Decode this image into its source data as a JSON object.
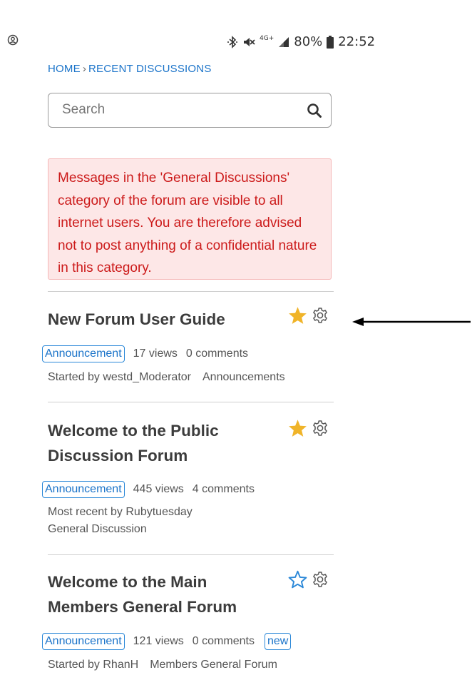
{
  "status_bar": {
    "signal_label": "4G+",
    "battery_percent": "80%",
    "time": "22:52",
    "icons": [
      "account-icon",
      "bluetooth-icon",
      "mute-icon",
      "signal-icon",
      "battery-icon"
    ]
  },
  "breadcrumb": {
    "home": "HOME",
    "separator": "›",
    "current": "RECENT DISCUSSIONS"
  },
  "search": {
    "placeholder": "Search"
  },
  "alert": {
    "message": "Messages in the 'General Discussions' category of the forum are visible to all internet users. You are therefore advised not to post anything of a confidential nature in this category."
  },
  "discussions": [
    {
      "title": "New Forum User Guide",
      "starred": true,
      "badge": "Announcement",
      "views": "17 views",
      "comments": "0 comments",
      "line1": "Started by westd_Moderator",
      "category": "Announcements"
    },
    {
      "title": "Welcome to the Public Discussion Forum",
      "starred": true,
      "badge": "Announcement",
      "views": "445 views",
      "comments": "4 comments",
      "line1": "Most recent by Rubytuesday",
      "category": "General Discussion"
    },
    {
      "title": "Welcome to the Main Members General Forum",
      "starred": false,
      "badge": "Announcement",
      "views": "121 views",
      "comments": "0 comments",
      "new_label": "new",
      "line1": "Started by RhanH",
      "category": "Members General Forum"
    }
  ],
  "colors": {
    "link": "#1a73c9",
    "alert_text": "#cc1a1a",
    "alert_bg": "#fde7e7",
    "star_filled": "#f0b429",
    "star_outline": "#2b88d8"
  }
}
